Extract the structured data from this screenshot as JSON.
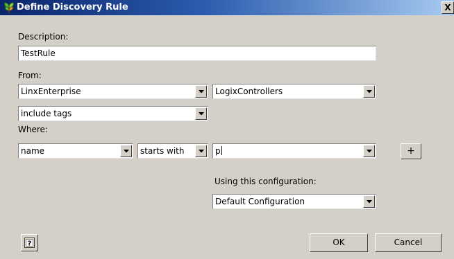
{
  "window": {
    "title": "Define Discovery Rule",
    "icon": "plant-icon",
    "close_glyph": "X"
  },
  "description": {
    "label": "Description:",
    "value": "TestRule"
  },
  "from": {
    "label": "From:",
    "source_value": "LinxEnterprise",
    "target_value": "LogixControllers",
    "include_value": "include tags"
  },
  "where": {
    "label": "Where:",
    "field_value": "name",
    "operator_value": "starts with",
    "match_value": "p",
    "add_label": "+"
  },
  "configuration": {
    "label": "Using this configuration:",
    "value": "Default Configuration"
  },
  "footer": {
    "help_icon": "help-icon",
    "ok_label": "OK",
    "cancel_label": "Cancel"
  }
}
